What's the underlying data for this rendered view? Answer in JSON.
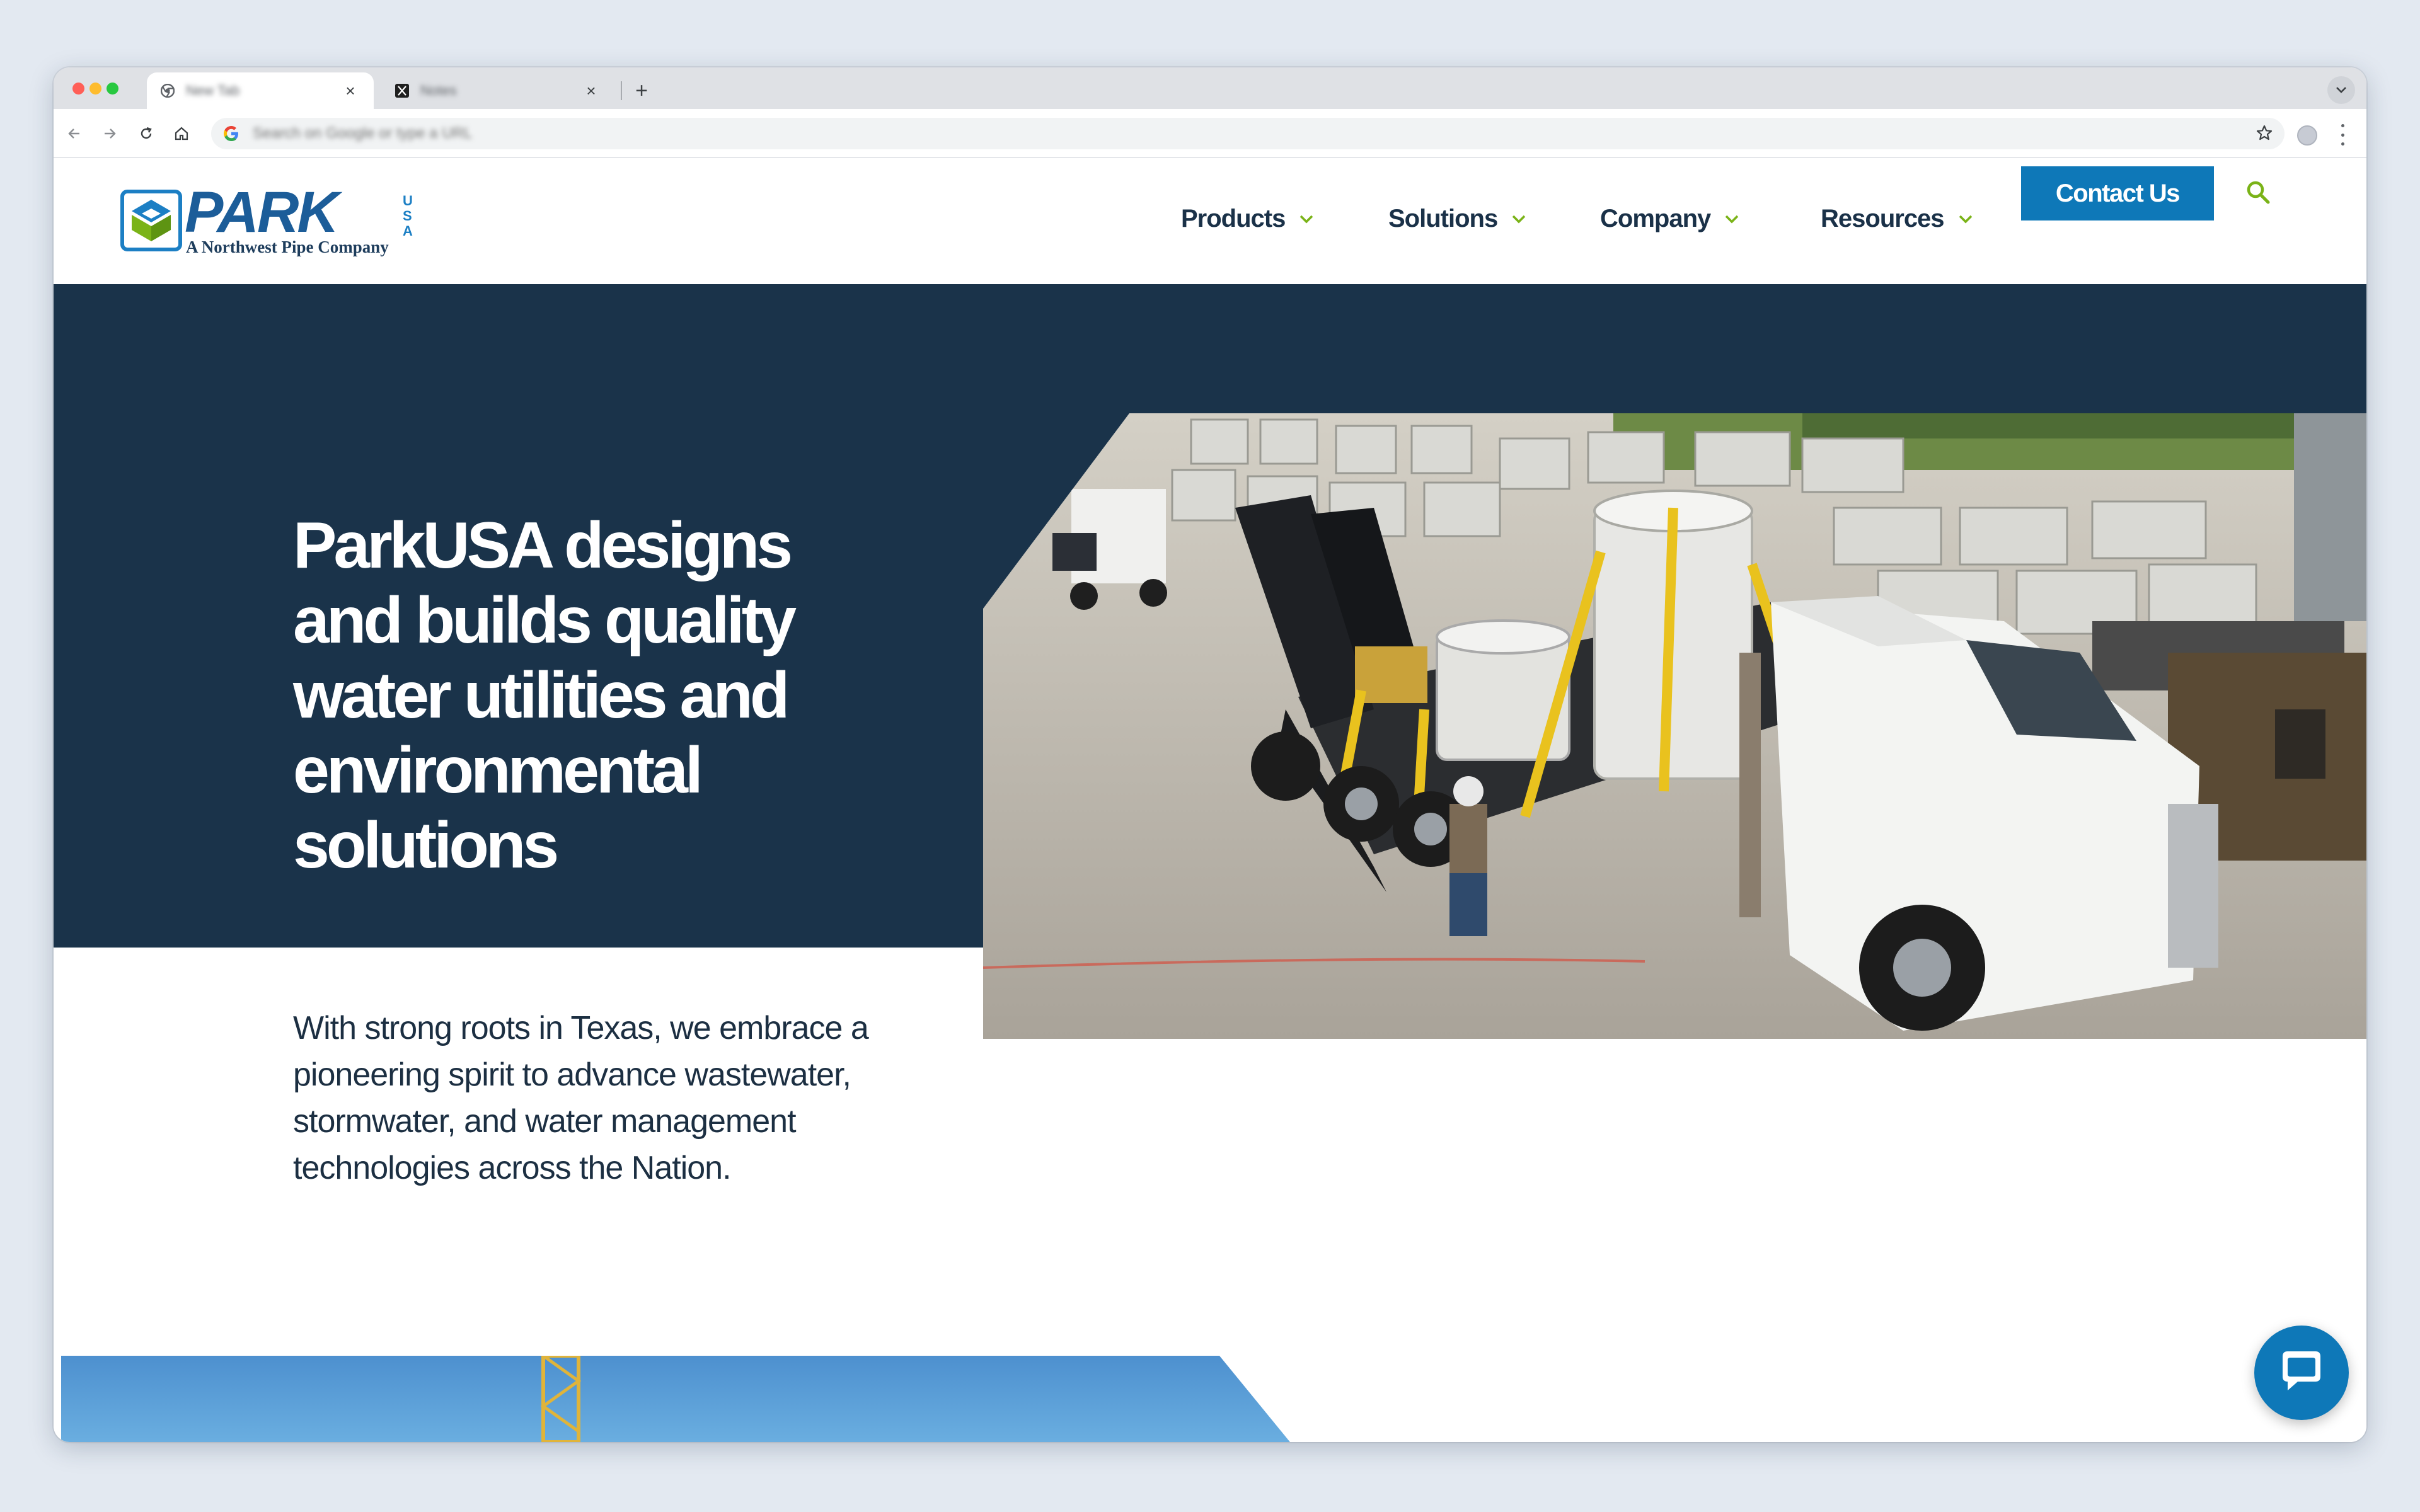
{
  "browser": {
    "tabs": [
      {
        "title": "New Tab",
        "active": true
      },
      {
        "title": "Notes",
        "active": false
      }
    ],
    "new_tab_label": "+",
    "omnibox_placeholder": "Search on Google or type a URL",
    "traffic_colors": [
      "#ff5f57",
      "#febc2e",
      "#28c840"
    ]
  },
  "site": {
    "logo": {
      "wordmark": "PARK",
      "usa_letters": [
        "U",
        "S",
        "A"
      ],
      "tagline": "A Northwest Pipe Company"
    },
    "nav": {
      "items": [
        {
          "label": "Products"
        },
        {
          "label": "Solutions"
        },
        {
          "label": "Company"
        },
        {
          "label": "Resources"
        }
      ],
      "contact_label": "Contact Us"
    },
    "hero": {
      "headline": "ParkUSA designs and builds quality water utilities and environmental solutions",
      "subcopy": "With strong roots in Texas, we embrace a pioneering spirit to advance wastewater, stormwater, and water management technologies across the Nation."
    },
    "colors": {
      "navy": "#1a334a",
      "brand_blue": "#0e78b8",
      "accent_green": "#7ab317",
      "nav_text": "#1a3148"
    }
  }
}
